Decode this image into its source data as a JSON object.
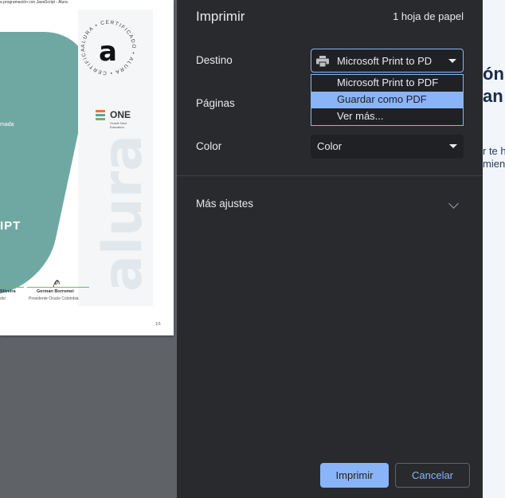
{
  "preview": {
    "header_text": "a programación con JavaScript - Alura",
    "teal_line1": "mada",
    "teal_line2": "IPT",
    "seal_ring_text": "ALURA • CERTIFICADO • ALURA • CERTIFICADO •",
    "seal_letter": "a",
    "watermark": "alura",
    "one_logo": {
      "name": "ONE",
      "subtitle": "Oracle Next Education"
    },
    "signatures": [
      {
        "name": "Silveira",
        "role": "dor"
      },
      {
        "name": "German Borromei",
        "role": "Presidente Oracle Colombia"
      }
    ],
    "page_number": "1/1",
    "colors": {
      "teal": "#6fa8a3",
      "logo_orange": "#e8783a",
      "logo_teal": "#5aa59c",
      "logo_green": "#7bb069"
    }
  },
  "dialog": {
    "title": "Imprimir",
    "sheet_count": "1 hoja de papel",
    "destination": {
      "label": "Destino",
      "value": "Microsoft Print to PD",
      "icon": "printer-icon",
      "options": [
        "Microsoft Print to PDF",
        "Guardar como PDF",
        "Ver más..."
      ],
      "highlighted_option": "Guardar como PDF"
    },
    "pages": {
      "label": "Páginas"
    },
    "color": {
      "label": "Color",
      "value": "Color"
    },
    "more_settings": {
      "label": "Más ajustes",
      "icon": "chevron-down-icon"
    },
    "buttons": {
      "print": "Imprimir",
      "cancel": "Cancelar"
    }
  },
  "background_page": {
    "heading_line1": "ón",
    "heading_line2": "an",
    "text_line1": "r te h",
    "text_line2": "mien"
  }
}
